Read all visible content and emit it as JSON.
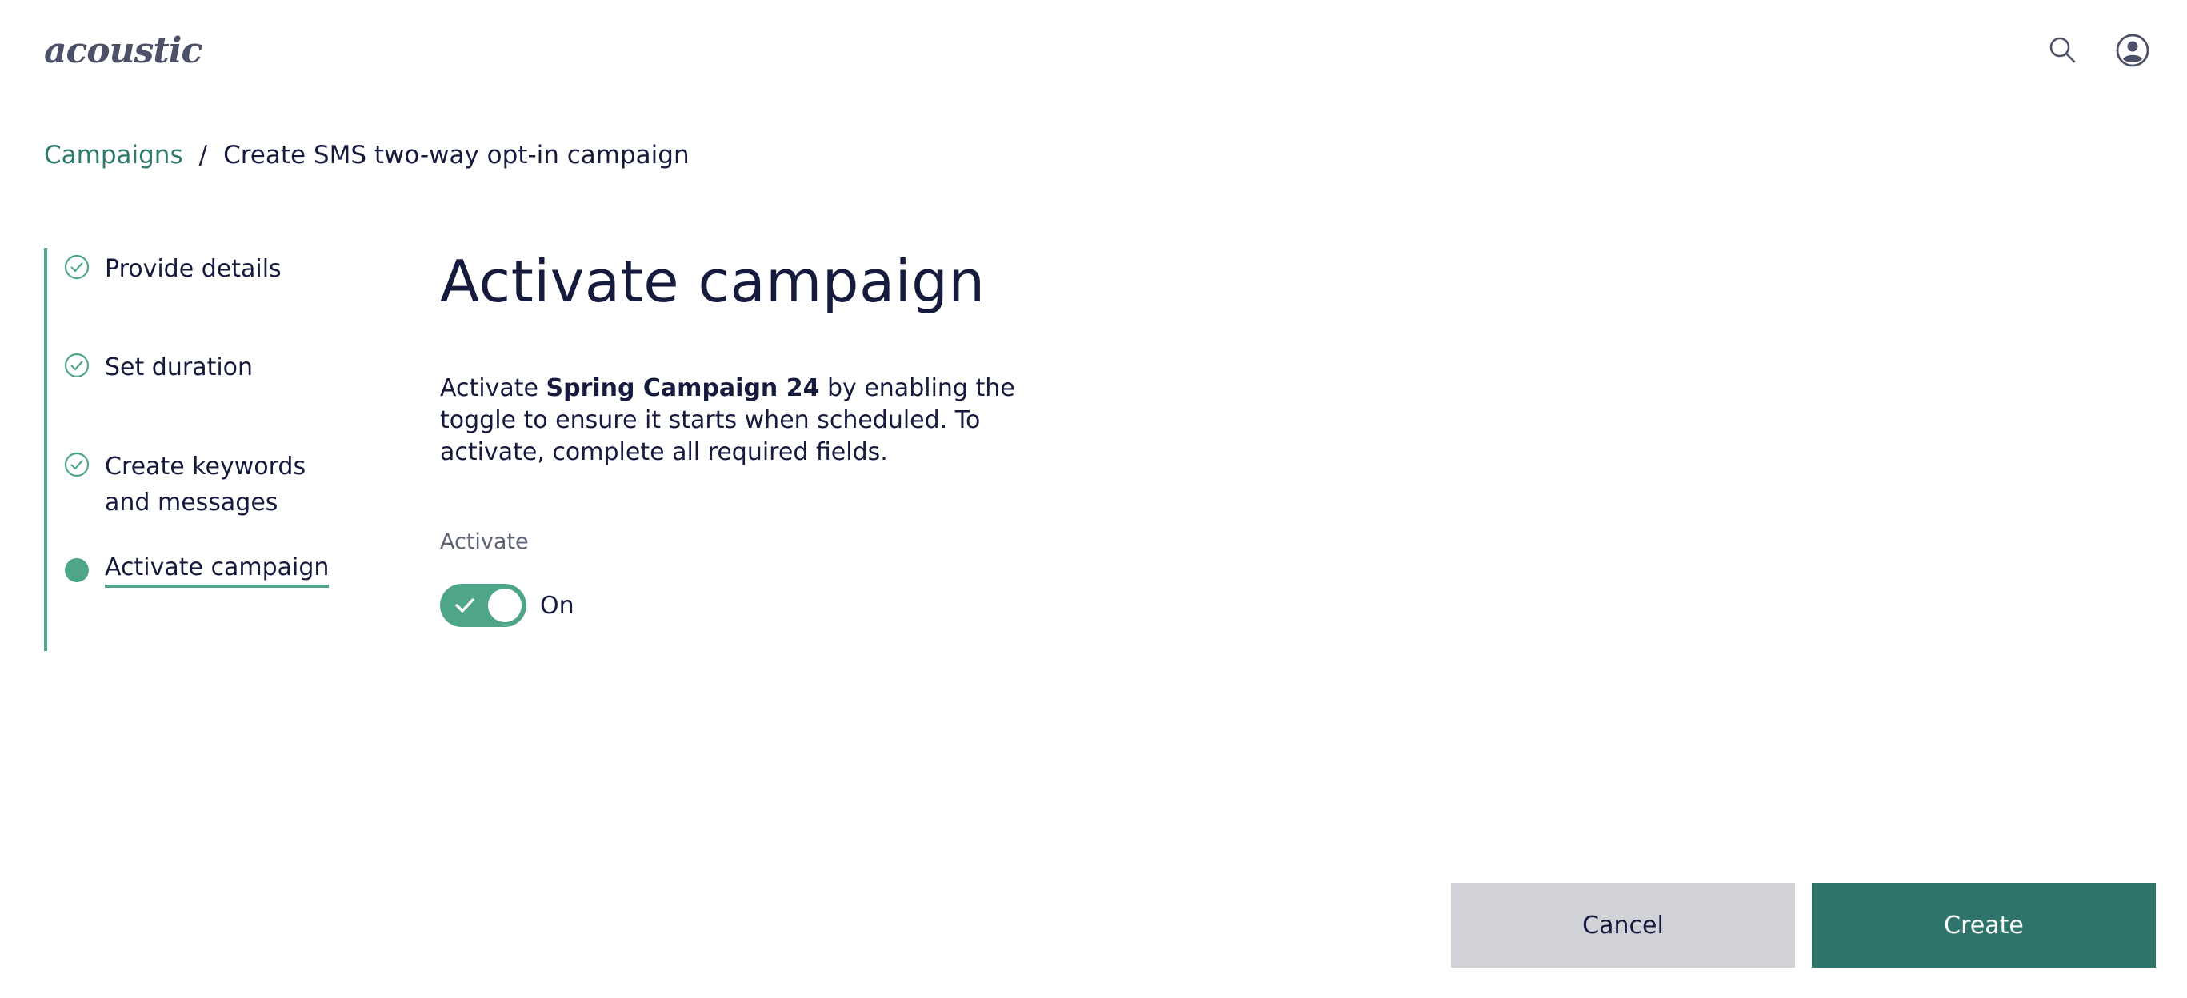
{
  "header": {
    "logo": "acoustic",
    "search_icon": "search-icon",
    "user_icon": "user-circle-icon"
  },
  "breadcrumb": {
    "link": "Campaigns",
    "separator": "/",
    "current": "Create SMS two-way opt-in campaign"
  },
  "steps": [
    {
      "label": "Provide details",
      "state": "complete",
      "icon": "check-circle-icon"
    },
    {
      "label": "Set duration",
      "state": "complete",
      "icon": "check-circle-icon"
    },
    {
      "label": "Create keywords and messages",
      "state": "complete",
      "icon": "check-circle-icon"
    },
    {
      "label": "Activate campaign",
      "state": "current",
      "icon": "filled-dot-icon"
    }
  ],
  "main": {
    "title": "Activate campaign",
    "desc_prefix": "Activate ",
    "campaign_name": "Spring Campaign 24",
    "desc_suffix": " by enabling the toggle to ensure it starts when scheduled. To activate, complete all required fields.",
    "field_label": "Activate",
    "toggle_state": "On",
    "toggle_on": true
  },
  "actions": {
    "cancel": "Cancel",
    "create": "Create"
  },
  "colors": {
    "accent": "#4fa58a",
    "link": "#2f7a6c",
    "primary_button": "#30756b",
    "secondary_button": "#d1d2d7",
    "text": "#161b3d"
  }
}
